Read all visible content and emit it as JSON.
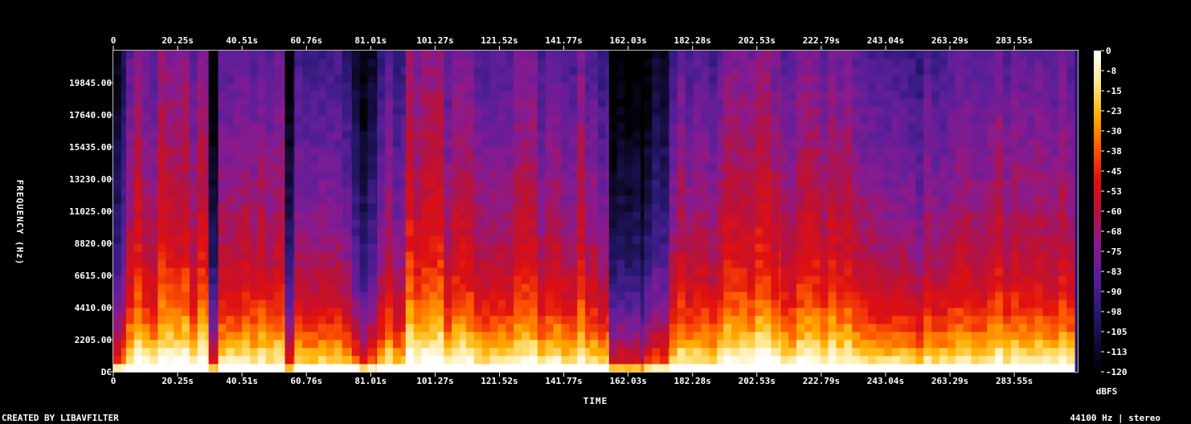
{
  "footer": {
    "credit": "CREATED BY LIBAVFILTER",
    "info": "44100 Hz | stereo"
  },
  "chart_data": {
    "type": "heatmap",
    "title": "",
    "xlabel": "TIME",
    "ylabel": "FREQUENCY (Hz)",
    "x_unit": "s",
    "x_tick_labels": [
      "0",
      "20.25s",
      "40.51s",
      "60.76s",
      "81.01s",
      "101.27s",
      "121.52s",
      "141.77s",
      "162.03s",
      "182.28s",
      "202.53s",
      "222.79s",
      "243.04s",
      "263.29s",
      "283.55s"
    ],
    "x_ticks": [
      0,
      20.25,
      40.51,
      60.76,
      81.01,
      101.27,
      121.52,
      141.77,
      162.03,
      182.28,
      202.53,
      222.79,
      243.04,
      263.29,
      283.55
    ],
    "xlim": [
      0,
      303.5
    ],
    "y_tick_labels": [
      "DC",
      "2205.00",
      "4410.00",
      "6615.00",
      "8820.00",
      "11025.00",
      "13230.00",
      "15435.00",
      "17640.00",
      "19845.00"
    ],
    "y_ticks": [
      0,
      2205,
      4410,
      6615,
      8820,
      11025,
      13230,
      15435,
      17640,
      19845
    ],
    "ylim": [
      0,
      22050
    ],
    "colorbar": {
      "label": "dBFS",
      "tick_labels": [
        "0",
        "-8",
        "-15",
        "-23",
        "-30",
        "-38",
        "-45",
        "-53",
        "-60",
        "-68",
        "-75",
        "-83",
        "-90",
        "-98",
        "-105",
        "-113",
        "-120"
      ],
      "range": [
        -120,
        0
      ],
      "colors": [
        "#000000",
        "#140d3c",
        "#2c1a78",
        "#5a1f9a",
        "#8a1a8e",
        "#b8123a",
        "#e01010",
        "#ff5a00",
        "#ffb000",
        "#ffe890",
        "#ffffff"
      ]
    },
    "segments": [
      {
        "start": 0,
        "end": 4,
        "level": 0.35
      },
      {
        "start": 4,
        "end": 30,
        "level": 0.62
      },
      {
        "start": 30,
        "end": 33,
        "level": 0.22
      },
      {
        "start": 33,
        "end": 54,
        "level": 0.55
      },
      {
        "start": 54,
        "end": 57,
        "level": 0.3
      },
      {
        "start": 57,
        "end": 75,
        "level": 0.5
      },
      {
        "start": 75,
        "end": 83,
        "level": 0.3
      },
      {
        "start": 83,
        "end": 92,
        "level": 0.5
      },
      {
        "start": 92,
        "end": 104,
        "level": 0.68
      },
      {
        "start": 104,
        "end": 111,
        "level": 0.6
      },
      {
        "start": 111,
        "end": 150,
        "level": 0.58
      },
      {
        "start": 150,
        "end": 156,
        "level": 0.5
      },
      {
        "start": 156,
        "end": 167,
        "level": 0.2
      },
      {
        "start": 167,
        "end": 175,
        "level": 0.3
      },
      {
        "start": 175,
        "end": 192,
        "level": 0.56
      },
      {
        "start": 192,
        "end": 210,
        "level": 0.66
      },
      {
        "start": 210,
        "end": 240,
        "level": 0.6
      },
      {
        "start": 240,
        "end": 260,
        "level": 0.52
      },
      {
        "start": 260,
        "end": 302,
        "level": 0.57
      }
    ]
  }
}
